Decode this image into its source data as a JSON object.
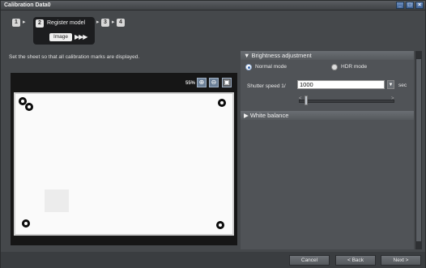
{
  "window": {
    "title": "Calibration Data0",
    "minimize_icon": "minimize-icon",
    "maximize_icon": "maximize-icon",
    "close_icon": "close-icon"
  },
  "wizard": {
    "steps": [
      {
        "number": "1"
      },
      {
        "number": "2",
        "label": "Register model",
        "current": true
      },
      {
        "number": "3"
      },
      {
        "number": "4"
      }
    ],
    "substep_label": "Image",
    "substep_progress": "▶▶▶"
  },
  "instruction": "Set the sheet so that all calibration marks are displayed.",
  "viewer": {
    "zoom_level": "55%",
    "zoom_in_icon": "zoom-in-icon",
    "zoom_out_icon": "zoom-out-icon",
    "fit_icon": "fit-icon"
  },
  "brightness": {
    "header": "▼ Brightness adjustment",
    "normal_mode": "Normal mode",
    "hdr_mode": "HDR mode",
    "selected_mode": "Normal mode",
    "shutter_label": "Shutter speed 1/",
    "shutter_value": "1000",
    "shutter_unit": "sec",
    "slider_left": "<",
    "slider_right": ">"
  },
  "white_balance": {
    "header": "▶ White balance"
  },
  "footer": {
    "cancel": "Cancel",
    "back": "< Back",
    "next": "Next >"
  },
  "colors": {
    "accent": "#3a6ab0",
    "background": "#45484b"
  }
}
